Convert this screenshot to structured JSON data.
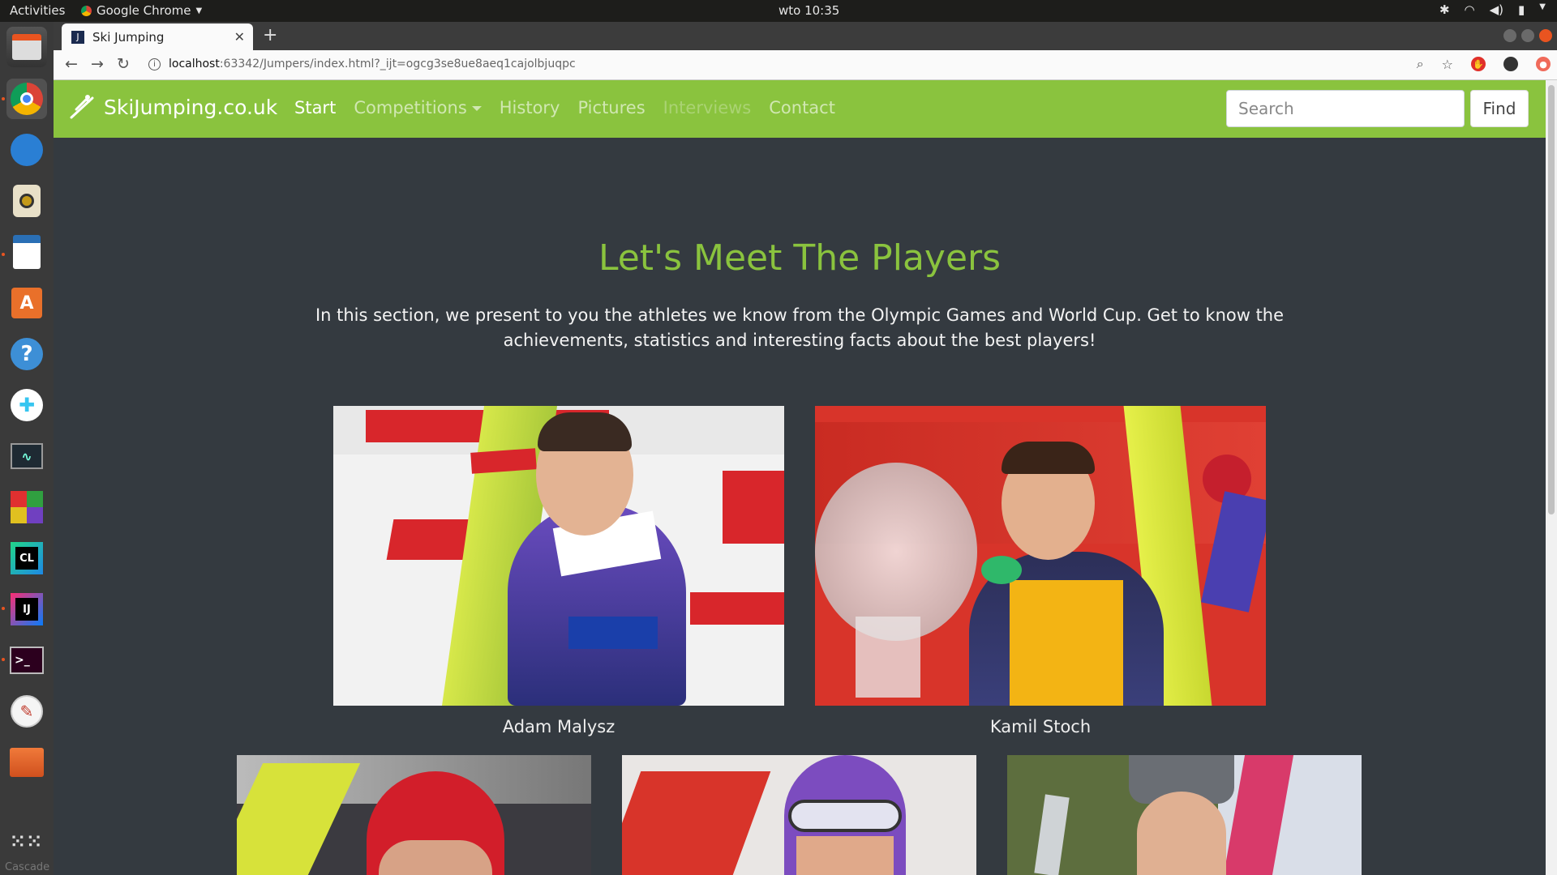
{
  "os": {
    "activities": "Activities",
    "app_name": "Google Chrome",
    "clock": "wto 10:35"
  },
  "dock": {
    "apps": [
      "chrome-icon",
      "thunderbird-icon",
      "rhythmbox-icon",
      "writer-icon",
      "software-center-icon",
      "help-icon",
      "slack-icon",
      "system-monitor-icon",
      "gnome-ware-icon",
      "clion-icon",
      "intellij-icon",
      "terminal-icon",
      "text-editor-icon",
      "files-icon",
      "app-grid-icon"
    ],
    "footer_label": "Cascade"
  },
  "browser": {
    "tab_title": "Ski Jumping",
    "url_host": "localhost",
    "url_rest": ":63342/Jumpers/index.html?_ijt=ogcg3se8ue8aeq1cajolbjuqpc"
  },
  "site": {
    "brand": "SkiJumping.co.uk",
    "nav": [
      {
        "label": "Start",
        "state": "active"
      },
      {
        "label": "Competitions",
        "state": "dropdown"
      },
      {
        "label": "History",
        "state": "normal"
      },
      {
        "label": "Pictures",
        "state": "normal"
      },
      {
        "label": "Interviews",
        "state": "disabled"
      },
      {
        "label": "Contact",
        "state": "normal"
      }
    ],
    "search_placeholder": "Search",
    "find_label": "Find",
    "heading": "Let's Meet The Players",
    "lead": "In this section, we present to you the athletes we know from the Olympic Games and World Cup. Get to know the achievements, statistics and interesting facts about the best players!",
    "players_row1": [
      {
        "name": "Adam Malysz"
      },
      {
        "name": "Kamil Stoch"
      }
    ]
  },
  "colors": {
    "accent": "#8ac33e",
    "page_bg": "#343a40"
  }
}
